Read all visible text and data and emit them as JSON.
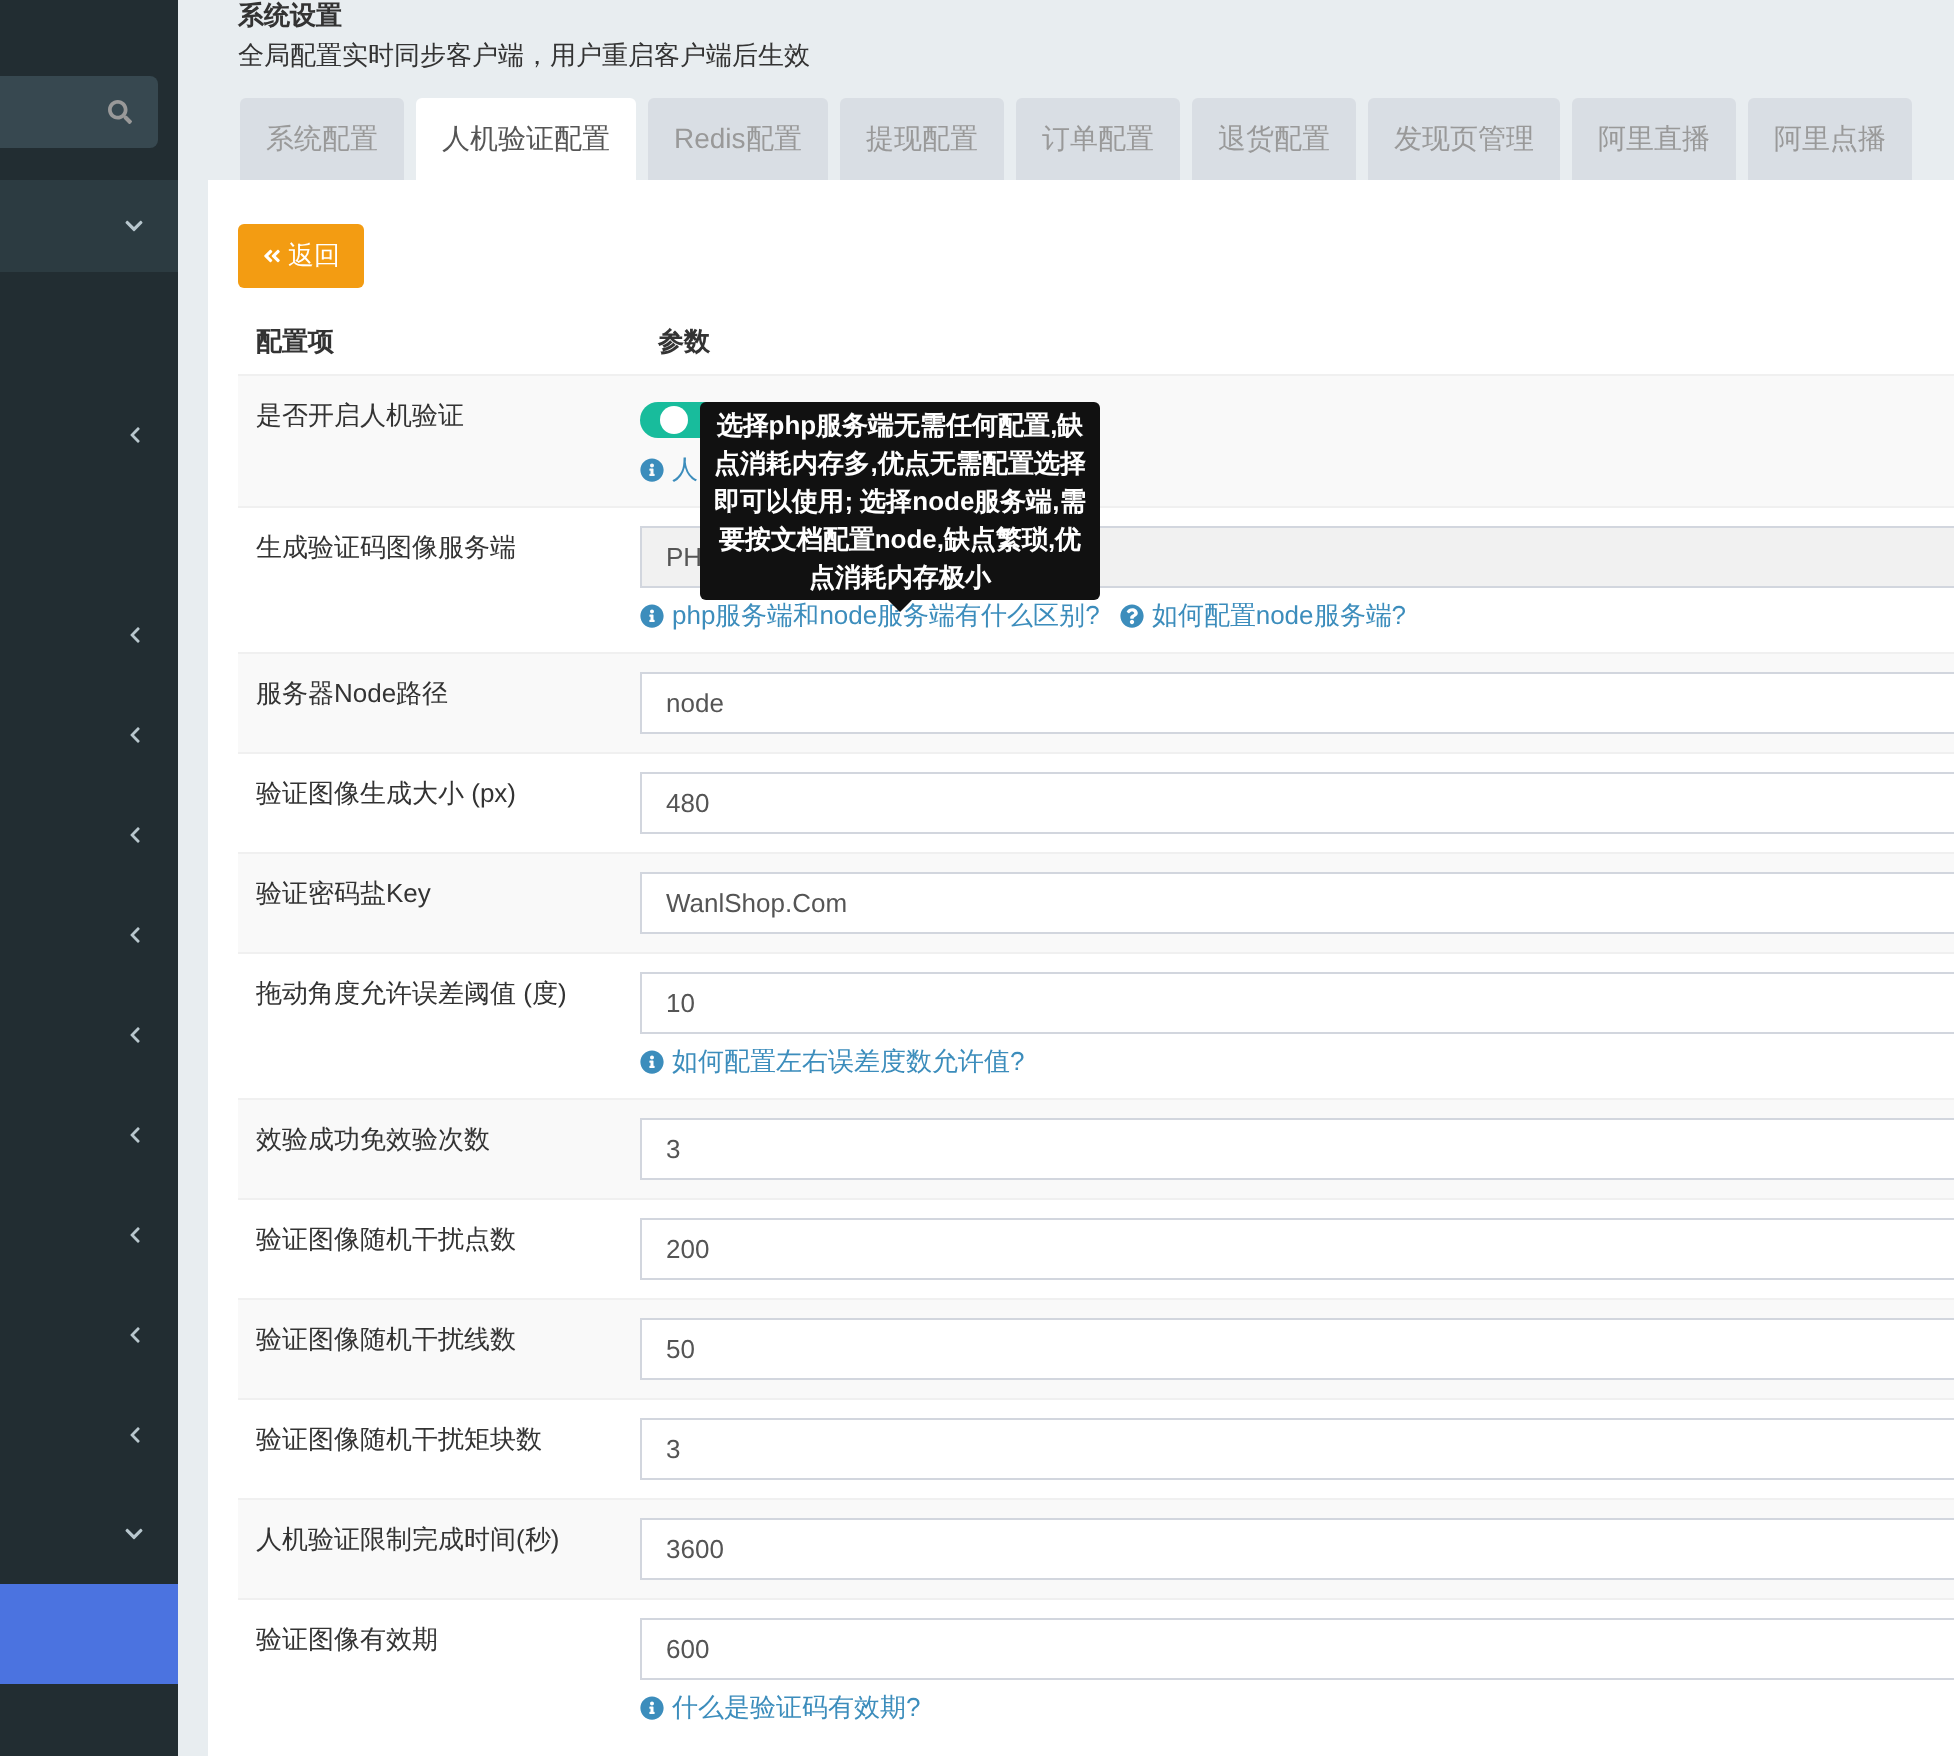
{
  "sidebar": {
    "items": [
      {
        "kind": "expanded",
        "selected": false,
        "header": true
      },
      {
        "kind": "plain",
        "selected": false
      },
      {
        "kind": "collapsed",
        "selected": false
      },
      {
        "kind": "plain",
        "selected": false
      },
      {
        "kind": "collapsed",
        "selected": false
      },
      {
        "kind": "collapsed",
        "selected": false
      },
      {
        "kind": "collapsed",
        "selected": false
      },
      {
        "kind": "collapsed",
        "selected": false
      },
      {
        "kind": "collapsed",
        "selected": false
      },
      {
        "kind": "collapsed",
        "selected": false
      },
      {
        "kind": "collapsed",
        "selected": false
      },
      {
        "kind": "collapsed",
        "selected": false
      },
      {
        "kind": "collapsed",
        "selected": false
      },
      {
        "kind": "expanded",
        "selected": false
      },
      {
        "kind": "plain",
        "selected": true
      }
    ]
  },
  "header": {
    "title": "系统设置",
    "subtitle": "全局配置实时同步客户端，用户重启客户端后生效"
  },
  "tabs": [
    {
      "label": "系统配置",
      "selected": false
    },
    {
      "label": "人机验证配置",
      "selected": true
    },
    {
      "label": "Redis配置",
      "selected": false
    },
    {
      "label": "提现配置",
      "selected": false
    },
    {
      "label": "订单配置",
      "selected": false
    },
    {
      "label": "退货配置",
      "selected": false
    },
    {
      "label": "发现页管理",
      "selected": false
    },
    {
      "label": "阿里直播",
      "selected": false
    },
    {
      "label": "阿里点播",
      "selected": false
    }
  ],
  "back_button": {
    "label": "返回"
  },
  "table": {
    "columns": [
      "配置项",
      "参数"
    ],
    "rows": [
      {
        "label": "是否开启人机验证",
        "kind": "toggle",
        "on": true,
        "help": [
          {
            "kind": "info",
            "text": "人"
          }
        ]
      },
      {
        "label": "生成验证码图像服务端",
        "kind": "select",
        "value": "PH",
        "help": [
          {
            "kind": "info",
            "text": "php服务端和node服务端有什么区别?"
          },
          {
            "kind": "question",
            "text": "如何配置node服务端?"
          }
        ]
      },
      {
        "label": "服务器Node路径",
        "kind": "input",
        "value": "node"
      },
      {
        "label": "验证图像生成大小 (px)",
        "kind": "input",
        "value": "480"
      },
      {
        "label": "验证密码盐Key",
        "kind": "input",
        "value": "WanlShop.Com"
      },
      {
        "label": "拖动角度允许误差阈值 (度)",
        "kind": "input",
        "value": "10",
        "help": [
          {
            "kind": "info",
            "text": "如何配置左右误差度数允许值?"
          }
        ]
      },
      {
        "label": "效验成功免效验次数",
        "kind": "input",
        "value": "3"
      },
      {
        "label": "验证图像随机干扰点数",
        "kind": "input",
        "value": "200"
      },
      {
        "label": "验证图像随机干扰线数",
        "kind": "input",
        "value": "50"
      },
      {
        "label": "验证图像随机干扰矩块数",
        "kind": "input",
        "value": "3"
      },
      {
        "label": "人机验证限制完成时间(秒)",
        "kind": "input",
        "value": "3600"
      },
      {
        "label": "验证图像有效期",
        "kind": "input",
        "value": "600",
        "help": [
          {
            "kind": "info",
            "text": "什么是验证码有效期?"
          }
        ]
      }
    ]
  },
  "tooltip": {
    "text": "选择php服务端无需任何配置,缺点消耗内存多,优点无需配置选择即可以使用; 选择node服务端,需要按文档配置node,缺点繁琐,优点消耗内存极小"
  }
}
